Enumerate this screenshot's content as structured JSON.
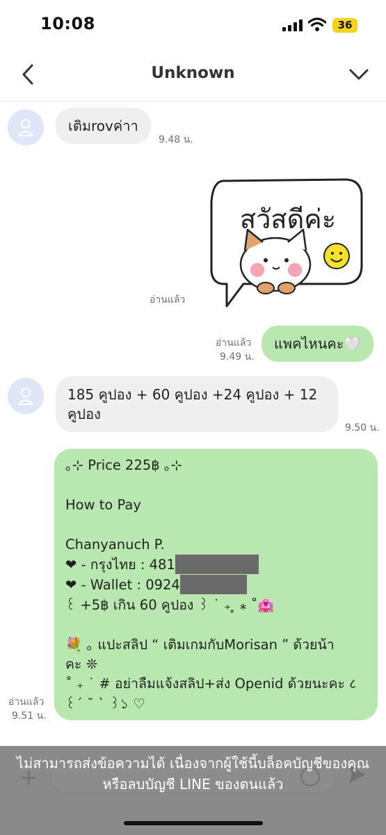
{
  "status_bar": {
    "time": "10:08",
    "battery": "36"
  },
  "header": {
    "title": "Unknown"
  },
  "messages": {
    "m1": {
      "text": "เติมrovค่าา",
      "time": "9.48 น."
    },
    "m2": {
      "sticker_text": "สวัสดีค่ะ",
      "read": "อ่านแล้ว"
    },
    "m3": {
      "text": "แพคไหนคะ🤍",
      "read": "อ่านแล้ว",
      "time": "9.49 น."
    },
    "m4": {
      "line1": "185 คูปอง + 60 คูปอง +24 คูปอง + 12",
      "line2": "คูปอง",
      "time": "9.50 น."
    },
    "m5": {
      "lines": [
        "｡⊹  Price 225฿  ｡⊹",
        "",
        "How to Pay",
        "",
        "Chanyanuch P.",
        "❤  - กรุงไทย : 481",
        "❤  - Wallet : 0924",
        "  ꒰ +5฿ เกิน 60 คูปอง ꒱ ˙ ₊  ̥  ⁎ ˚🏩",
        "",
        "💐  ｡ แปะสลิป “ เติมเกมกับMorisan ” ด้วยน้า",
        "คะ ❊",
        "˚ ₊ ˙ # อย่าลืมแจ้งสลิป+ส่ง Openid ด้วยนะคะ ८",
        "꒰´ ˘ `  ꒱১ ♡"
      ],
      "read": "อ่านแล้ว",
      "time": "9.51 น."
    }
  },
  "overlay": {
    "line1": "ไม่สามารถส่งข้อความได้ เนื่องจากผู้ใช้นี้บล็อคบัญชีของคุณ",
    "line2": "หรือลบบัญชี LINE ของตนแล้ว"
  },
  "input": {
    "plus": "+"
  },
  "colors": {
    "outgoing_bubble": "#b8e8b0",
    "incoming_bubble": "#efefef",
    "battery": "#f5d21c"
  },
  "icons": [
    "back-icon",
    "chevron-down-icon",
    "user-avatar-icon",
    "plus-icon",
    "emoji-icon",
    "send-icon",
    "signal-icon",
    "wifi-icon"
  ]
}
